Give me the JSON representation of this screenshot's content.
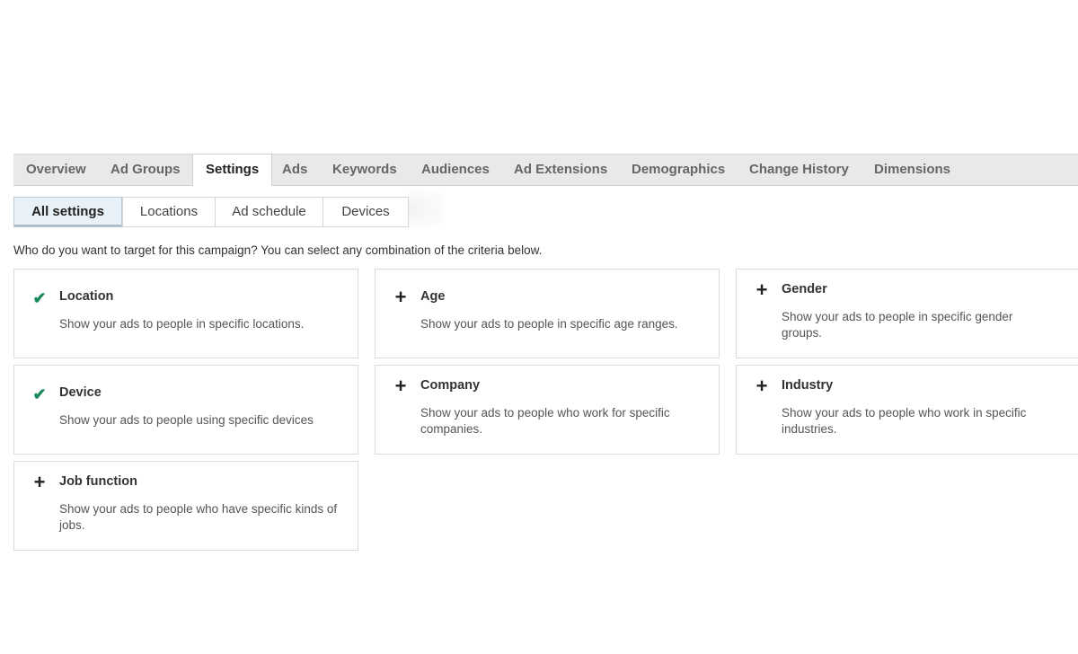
{
  "tabs": [
    {
      "label": "Overview"
    },
    {
      "label": "Ad Groups"
    },
    {
      "label": "Settings",
      "active": true
    },
    {
      "label": "Ads"
    },
    {
      "label": "Keywords"
    },
    {
      "label": "Audiences"
    },
    {
      "label": "Ad Extensions"
    },
    {
      "label": "Demographics"
    },
    {
      "label": "Change History"
    },
    {
      "label": "Dimensions"
    }
  ],
  "subtabs": [
    {
      "label": "All settings",
      "active": true
    },
    {
      "label": "Locations"
    },
    {
      "label": "Ad schedule"
    },
    {
      "label": "Devices"
    }
  ],
  "prompt": "Who do you want to target for this campaign? You can select any combination of the criteria below.",
  "cards": [
    {
      "title": "Location",
      "desc": "Show your ads to people in specific locations.",
      "icon": "check-icon"
    },
    {
      "title": "Age",
      "desc": "Show your ads to people in specific age ranges.",
      "icon": "plus-icon"
    },
    {
      "title": "Gender",
      "desc": "Show your ads to people in specific gender groups.",
      "icon": "plus-icon"
    },
    {
      "title": "Device",
      "desc": "Show your ads to people using specific devices",
      "icon": "check-icon"
    },
    {
      "title": "Company",
      "desc": "Show your ads to people who work for specific companies.",
      "icon": "plus-icon"
    },
    {
      "title": "Industry",
      "desc": "Show your ads to people who work in specific industries.",
      "icon": "plus-icon"
    },
    {
      "title": "Job function",
      "desc": "Show your ads to people who have specific kinds of jobs.",
      "icon": "plus-icon"
    }
  ],
  "colors": {
    "check": "#1b8a5a",
    "active_subtab_bg": "#e8f1f7",
    "tabbar_bg": "#e9e9e9"
  }
}
